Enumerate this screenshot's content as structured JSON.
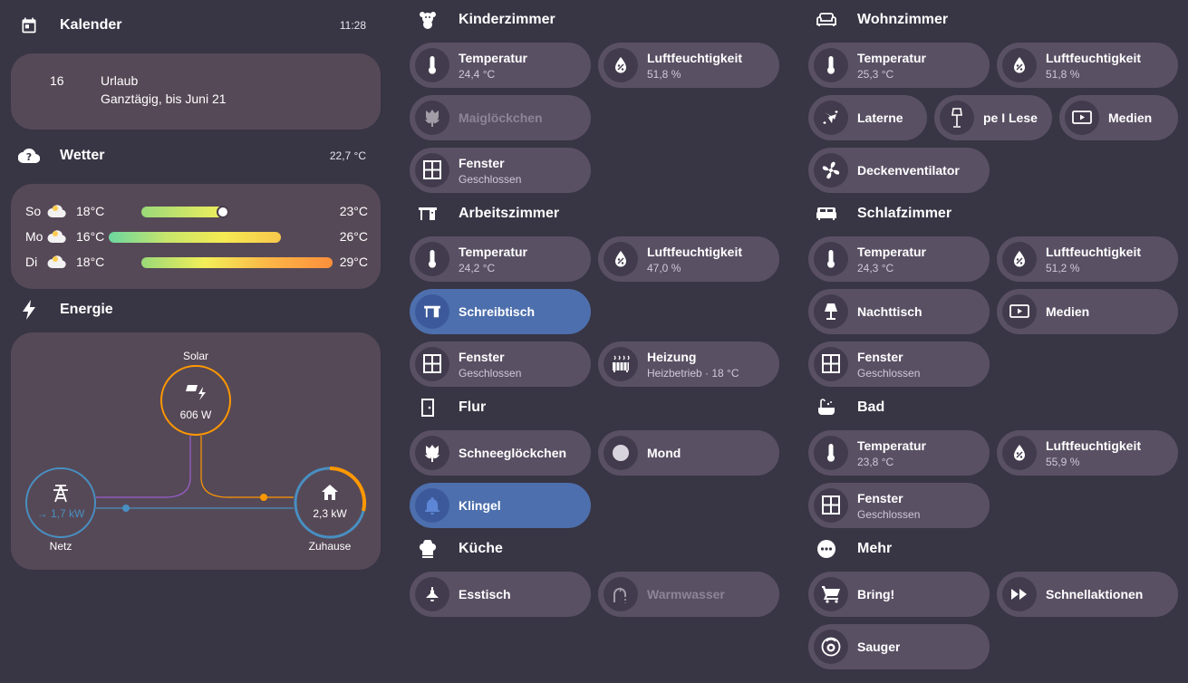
{
  "calendar": {
    "title": "Kalender",
    "time": "11:28",
    "event": {
      "day": "16",
      "title": "Urlaub",
      "detail": "Ganztägig, bis Juni 21"
    }
  },
  "weather": {
    "title": "Wetter",
    "current_temp": "22,7 °C",
    "days": [
      {
        "day": "So",
        "low": "18°C",
        "high": "23°C",
        "icon": "cloudy-icon"
      },
      {
        "day": "Mo",
        "low": "16°C",
        "high": "26°C",
        "icon": "cloudy-icon"
      },
      {
        "day": "Di",
        "low": "18°C",
        "high": "29°C",
        "icon": "cloudy-icon"
      }
    ]
  },
  "energy": {
    "title": "Energie",
    "solar_label": "Solar",
    "solar_value": "606 W",
    "grid_label": "Netz",
    "grid_value": "→ 1,7 kW",
    "home_label": "Zuhause",
    "home_value": "2,3 kW",
    "colors": {
      "solar": "#ff9800",
      "grid": "#488fc2",
      "home": "#488fc2"
    }
  },
  "rooms": {
    "kinderzimmer": {
      "title": "Kinderzimmer",
      "temperature": {
        "name": "Temperatur",
        "state": "24,4 °C"
      },
      "humidity": {
        "name": "Luftfeuchtigkeit",
        "state": "51,8 %"
      },
      "light": {
        "name": "Maiglöckchen"
      },
      "window": {
        "name": "Fenster",
        "state": "Geschlossen"
      }
    },
    "arbeitszimmer": {
      "title": "Arbeitszimmer",
      "temperature": {
        "name": "Temperatur",
        "state": "24,2 °C"
      },
      "humidity": {
        "name": "Luftfeuchtigkeit",
        "state": "47,0 %"
      },
      "desk": {
        "name": "Schreibtisch"
      },
      "window": {
        "name": "Fenster",
        "state": "Geschlossen"
      },
      "heating": {
        "name": "Heizung",
        "state": "Heizbetrieb · 18 °C"
      }
    },
    "flur": {
      "title": "Flur",
      "snowdrop": {
        "name": "Schneeglöckchen"
      },
      "moon": {
        "name": "Mond"
      },
      "bell": {
        "name": "Klingel"
      }
    },
    "kueche": {
      "title": "Küche",
      "dining": {
        "name": "Esstisch"
      },
      "water": {
        "name": "Warmwasser"
      }
    },
    "wohnzimmer": {
      "title": "Wohnzimmer",
      "temperature": {
        "name": "Temperatur",
        "state": "25,3 °C"
      },
      "humidity": {
        "name": "Luftfeuchtigkeit",
        "state": "51,8 %"
      },
      "lantern": {
        "name": "Laterne"
      },
      "reading_lamp": {
        "name": "pe I Lese"
      },
      "media": {
        "name": "Medien"
      },
      "fan": {
        "name": "Deckenventilator"
      }
    },
    "schlafzimmer": {
      "title": "Schlafzimmer",
      "temperature": {
        "name": "Temperatur",
        "state": "24,3 °C"
      },
      "humidity": {
        "name": "Luftfeuchtigkeit",
        "state": "51,2 %"
      },
      "nightstand": {
        "name": "Nachttisch"
      },
      "media": {
        "name": "Medien"
      },
      "window": {
        "name": "Fenster",
        "state": "Geschlossen"
      }
    },
    "bad": {
      "title": "Bad",
      "temperature": {
        "name": "Temperatur",
        "state": "23,8 °C"
      },
      "humidity": {
        "name": "Luftfeuchtigkeit",
        "state": "55,9 %"
      },
      "window": {
        "name": "Fenster",
        "state": "Geschlossen"
      }
    },
    "mehr": {
      "title": "Mehr",
      "bring": {
        "name": "Bring!"
      },
      "quick": {
        "name": "Schnellaktionen"
      },
      "vacuum": {
        "name": "Sauger"
      }
    }
  },
  "colors": {
    "background": "#383544",
    "card": "#564957",
    "tile": "#5a5064",
    "active_tile": "#4d6fad"
  }
}
